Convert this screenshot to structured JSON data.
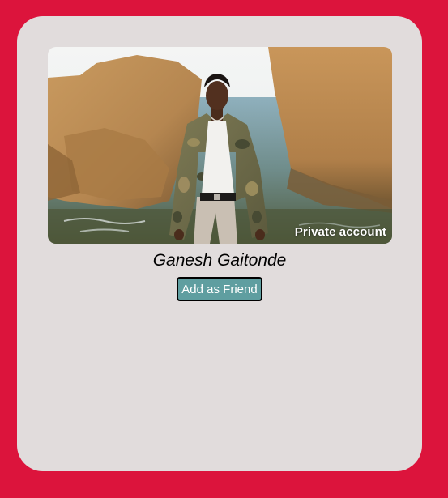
{
  "profile": {
    "name": "Ganesh Gaitonde",
    "photo_badge": "Private account",
    "add_button_label": "Add as Friend"
  },
  "colors": {
    "page_background": "#dc143c",
    "card_background": "#e1dcdc",
    "button_background": "#5f9ea0",
    "button_text": "#ffffff"
  }
}
